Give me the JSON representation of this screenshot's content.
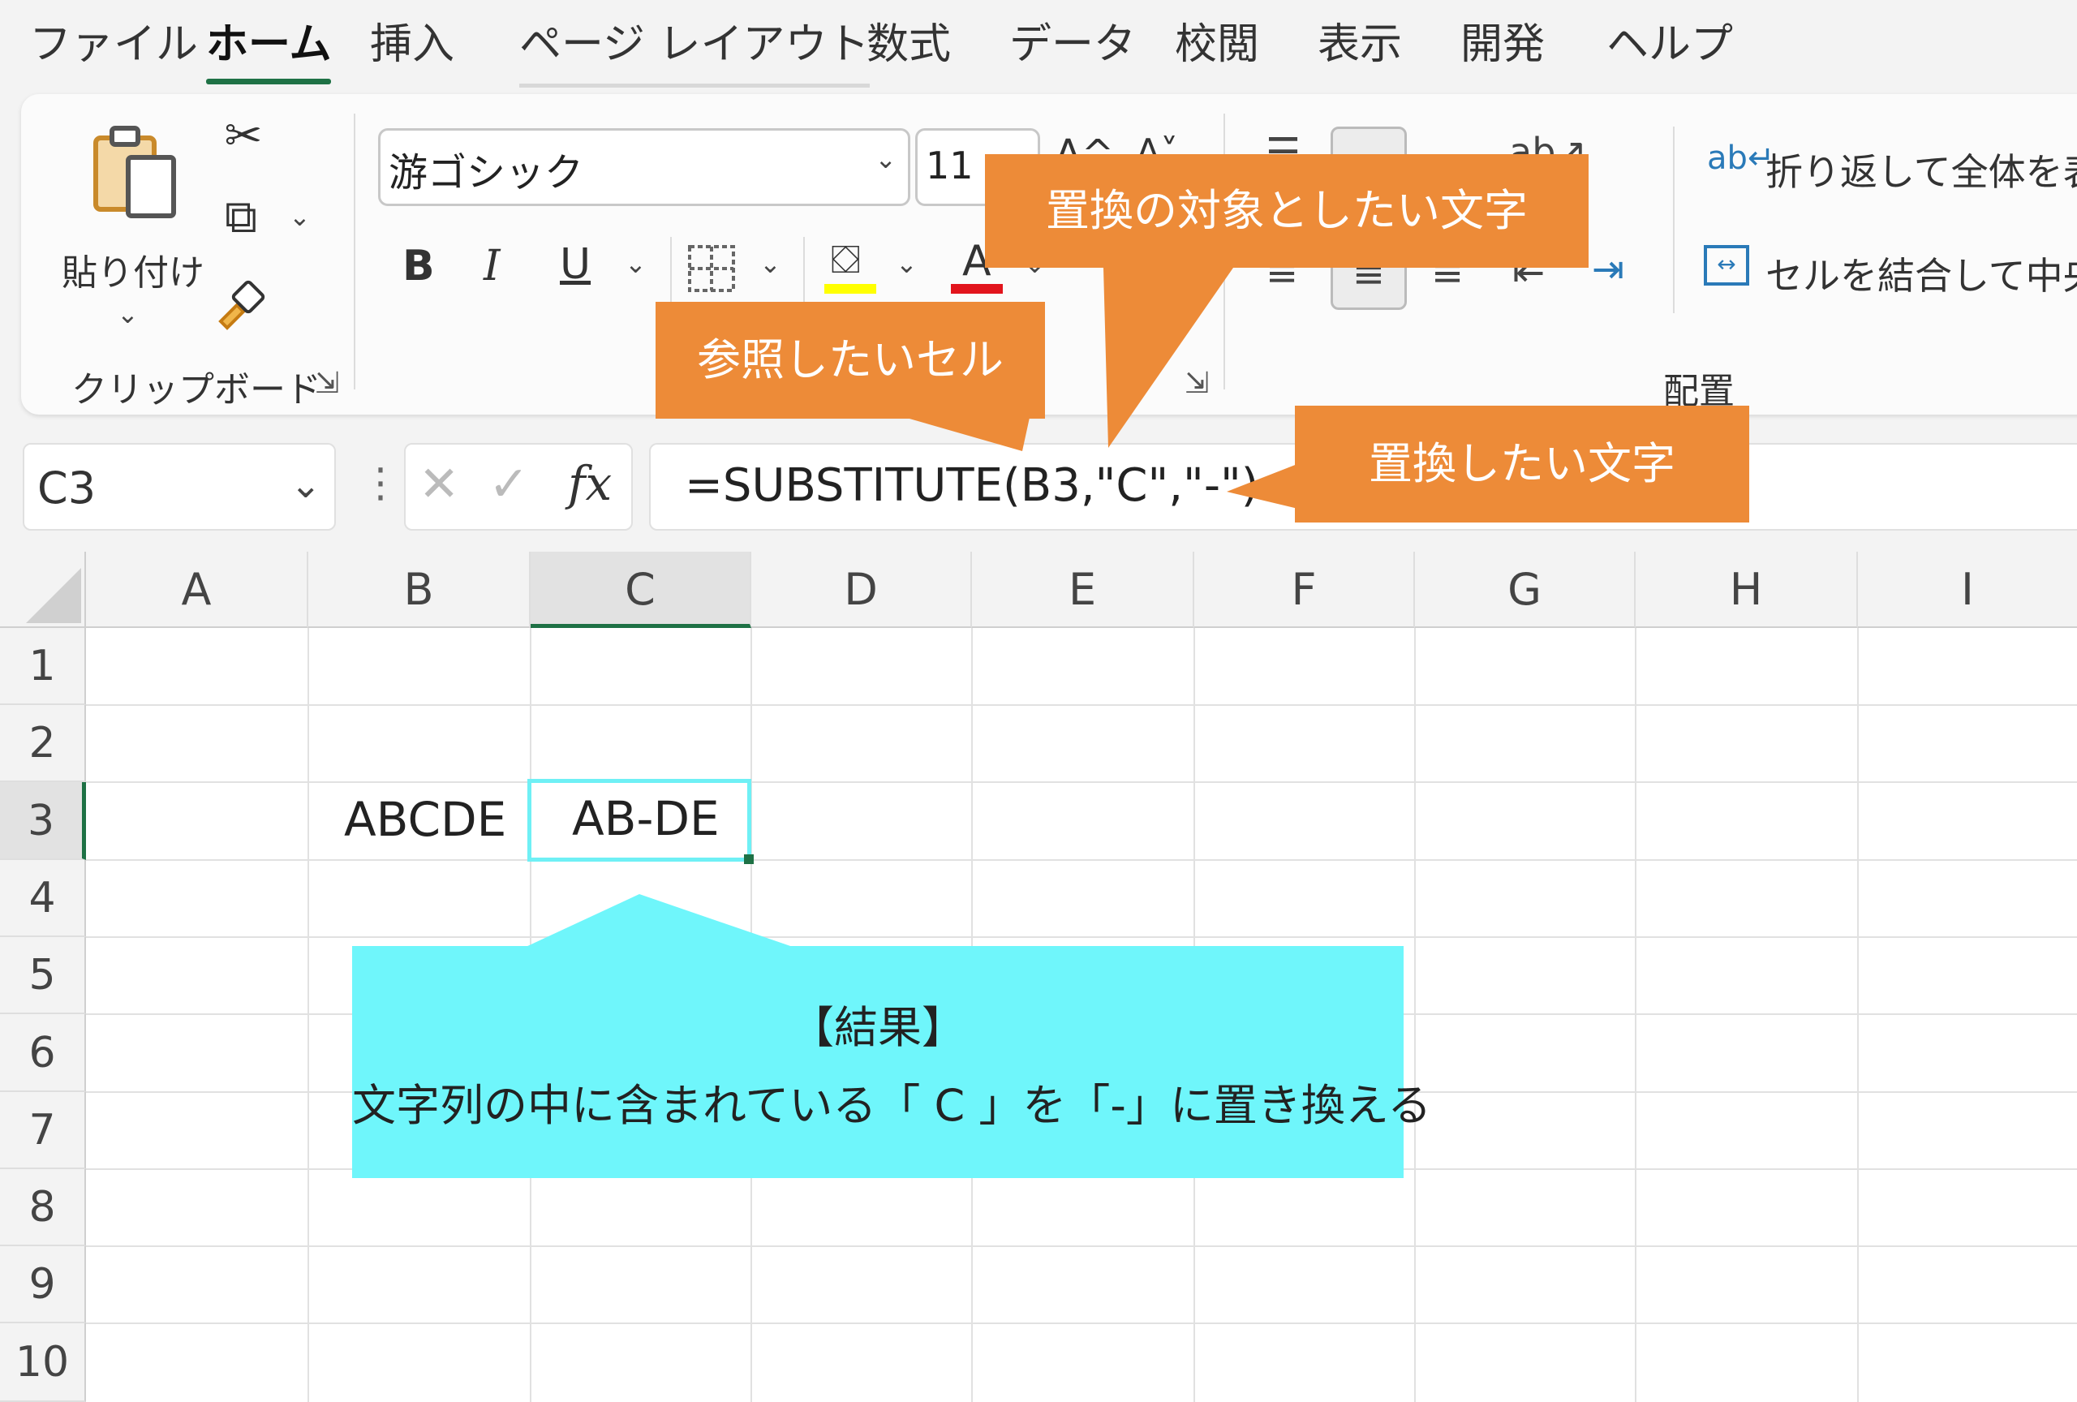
{
  "menu": {
    "tabs": [
      "ファイル",
      "ホーム",
      "挿入",
      "ページ レイアウト",
      "数式",
      "データ",
      "校閲",
      "表示",
      "開発",
      "ヘルプ"
    ],
    "active": "ホーム"
  },
  "ribbon": {
    "clipboard": {
      "paste_label": "貼り付け",
      "group_label": "クリップボード"
    },
    "font": {
      "name": "游ゴシック",
      "size": "11",
      "bold": "B",
      "italic": "I",
      "underline": "U",
      "font_color_glyph": "A"
    },
    "alignment": {
      "wrap_text": "折り返して全体を表示",
      "merge_center": "セルを結合して中央揃え",
      "group_label": "配置"
    }
  },
  "formula_bar": {
    "name_box": "C3",
    "fx": "fx",
    "formula": "=SUBSTITUTE(B3,\"C\",\"-\")"
  },
  "sheet": {
    "columns": [
      "A",
      "B",
      "C",
      "D",
      "E",
      "F",
      "G",
      "H",
      "I"
    ],
    "rows": [
      "1",
      "2",
      "3",
      "4",
      "5",
      "6",
      "7",
      "8",
      "9",
      "10"
    ],
    "cells": {
      "B3": "ABCDE",
      "C3": "AB-DE"
    },
    "selected": "C3"
  },
  "callouts": {
    "target_char": "置換の対象としたい文字",
    "ref_cell": "参照したいセル",
    "replace_char": "置換したい文字",
    "result_title": "【結果】",
    "result_body": "文字列の中に含まれている「 C 」を「-」に置き換える"
  },
  "colors": {
    "accent": "#1e7145",
    "callout_orange": "#ed8b38",
    "callout_cyan": "#6ff6fb"
  }
}
